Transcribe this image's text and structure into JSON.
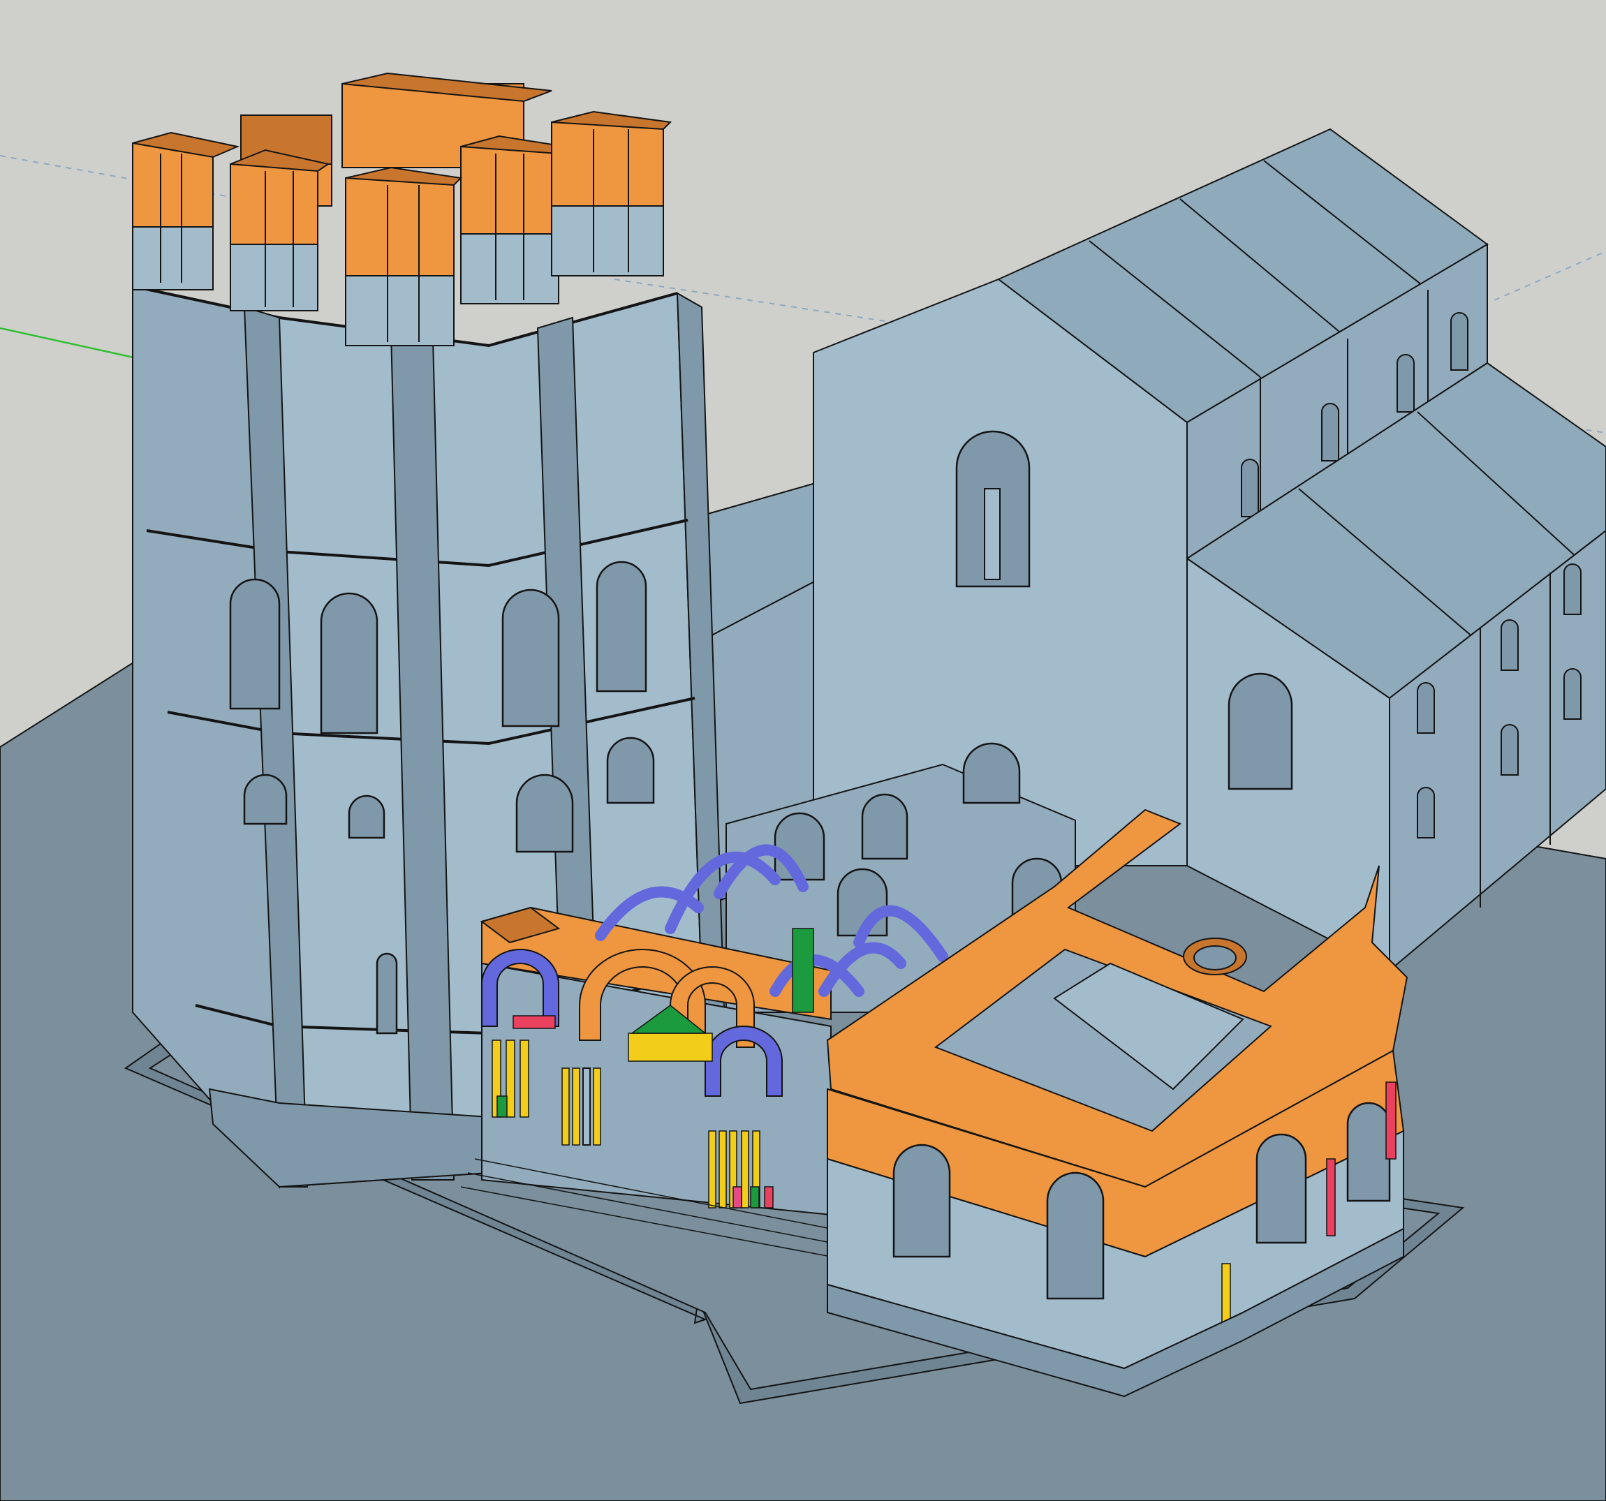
{
  "app": {
    "kind": "3d-modeling-viewport"
  },
  "colors": {
    "background": "#cfd0cc",
    "ground": "#7b8f9d",
    "ground_dark": "#6f8594",
    "wall_light": "#a3bccc",
    "wall_mid": "#93acbd",
    "wall_dark": "#7f98aa",
    "roof_top": "#8eaabb",
    "edge": "#141414",
    "phase_orange": "#ee9640",
    "phase_orange_dark": "#c8762e",
    "phase_blue": "#6368dc",
    "phase_yellow": "#f2cd1a",
    "phase_green": "#1c9a3e",
    "phase_pink": "#e9415e",
    "phase_magenta": "#e64a87",
    "axis_green": "#2fbf2f",
    "axis_guide": "#8da9c0"
  }
}
